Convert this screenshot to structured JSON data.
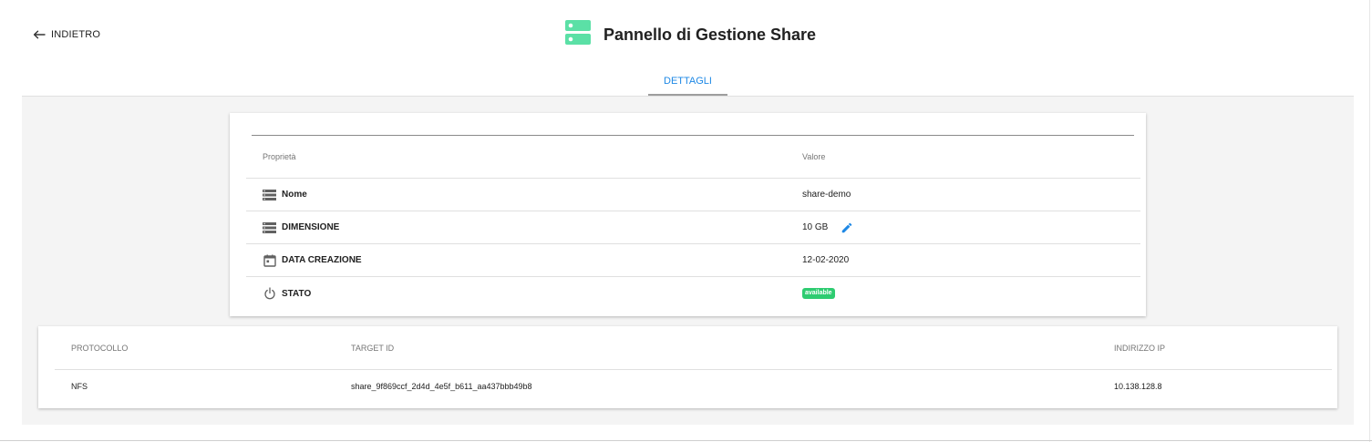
{
  "header": {
    "back_label": "INDIETRO",
    "title": "Pannello di Gestione Share",
    "tabs": [
      {
        "label": "DETTAGLI",
        "active": true
      }
    ]
  },
  "details": {
    "columns": {
      "property": "Proprietà",
      "value": "Valore"
    },
    "rows": [
      {
        "label": "Nome",
        "value": "share-demo",
        "icon": "storage-icon"
      },
      {
        "label": "DIMENSIONE",
        "value": "10 GB",
        "icon": "storage-icon",
        "editable": true
      },
      {
        "label": "DATA CREAZIONE",
        "value": "12-02-2020",
        "icon": "calendar-icon"
      },
      {
        "label": "STATO",
        "value": "available",
        "icon": "power-icon",
        "badge_color": "#2ecc71"
      }
    ]
  },
  "protocols": {
    "columns": [
      "PROTOCOLLO",
      "TARGET ID",
      "INDIRIZZO IP"
    ],
    "rows": [
      [
        "NFS",
        "share_9f869ccf_2d4d_4e5f_b611_aa437bbb49b8",
        "10.138.128.8"
      ]
    ]
  },
  "colors": {
    "accent": "#1e88e5",
    "title_icon": "#5be0a6",
    "status_available": "#2ecc71",
    "body_background": "#f4f4f4"
  }
}
